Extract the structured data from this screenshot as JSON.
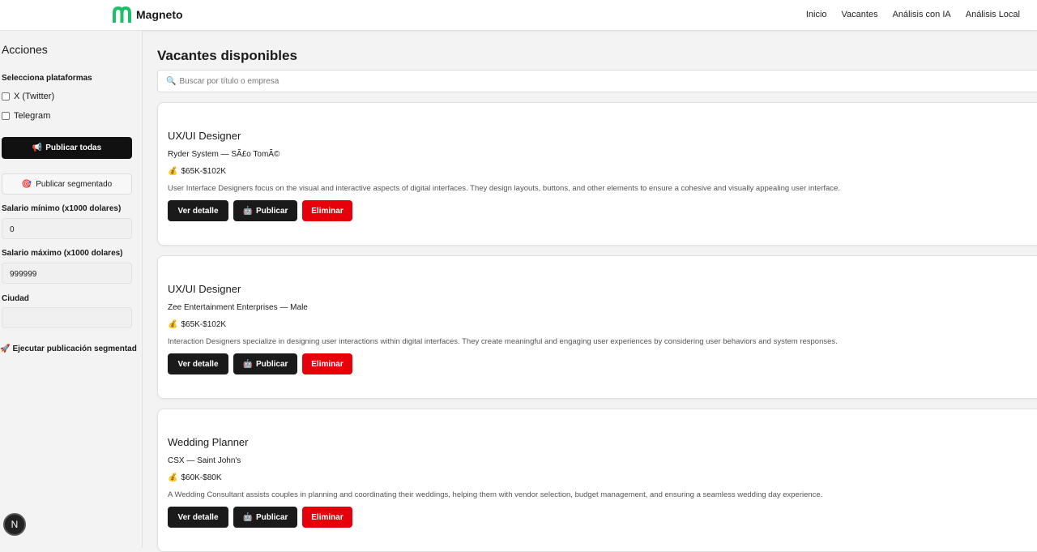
{
  "app": {
    "brand": "Magneto",
    "nav": [
      "Inicio",
      "Vacantes",
      "Análisis con IA",
      "Análisis Local"
    ]
  },
  "sidebar": {
    "title": "Acciones",
    "platforms_label": "Selecciona plataformas",
    "platforms": [
      {
        "label": "X (Twitter)",
        "checked": false
      },
      {
        "label": "Telegram",
        "checked": false
      }
    ],
    "publish_all_label": "Publicar todas",
    "publish_segmented_label": "Publicar segmentado",
    "min_salary_label": "Salario mínimo (x1000 dolares)",
    "min_salary_value": "0",
    "max_salary_label": "Salario máximo (x1000 dolares)",
    "max_salary_value": "999999",
    "city_label": "Ciudad",
    "city_value": "",
    "exec_label": "Ejecutar publicación segmentad"
  },
  "main": {
    "title": "Vacantes disponibles",
    "search_placeholder": "Buscar por título o empresa",
    "buttons": {
      "detail": "Ver detalle",
      "publish": "Publicar",
      "delete": "Eliminar"
    },
    "jobs": [
      {
        "title": "UX/UI Designer",
        "company": "Ryder System — SÃ£o TomÃ©",
        "salary": "$65K-$102K",
        "description": "User Interface Designers focus on the visual and interactive aspects of digital interfaces. They design layouts, buttons, and other elements to ensure a cohesive and visually appealing user interface."
      },
      {
        "title": "UX/UI Designer",
        "company": "Zee Entertainment Enterprises — Male",
        "salary": "$65K-$102K",
        "description": "Interaction Designers specialize in designing user interactions within digital interfaces. They create meaningful and engaging user experiences by considering user behaviors and system responses."
      },
      {
        "title": "Wedding Planner",
        "company": "CSX — Saint John's",
        "salary": "$60K-$80K",
        "description": "A Wedding Consultant assists couples in planning and coordinating their weddings, helping them with vendor selection, budget management, and ensuring a seamless wedding day experience."
      }
    ]
  },
  "badge": "N",
  "colors": {
    "brand_green": "#1fbf6a",
    "danger": "#e6000a",
    "dark": "#1a1a1a"
  },
  "icons": {
    "search": "search-icon",
    "megaphone": "megaphone-icon",
    "target": "target-icon",
    "money": "money-bag-icon",
    "robot": "robot-icon",
    "rocket": "rocket-icon"
  }
}
